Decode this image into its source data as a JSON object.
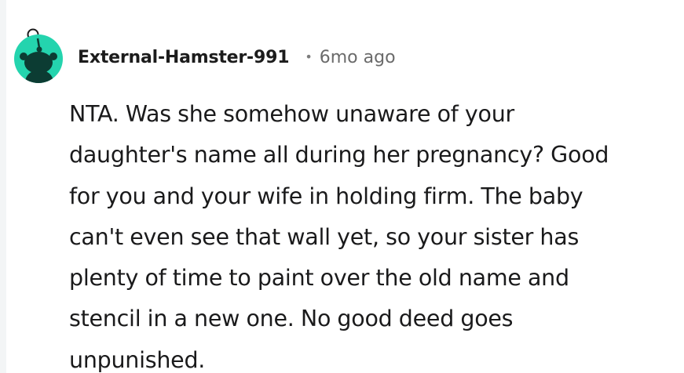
{
  "comment": {
    "author": "External-Hamster-991",
    "separator": "•",
    "timestamp": "6mo ago",
    "avatar_icon": "reddit-snoo-avatar-icon",
    "avatar_color": "#24d4ae",
    "body_lines": [
      "NTA. Was she somehow unaware of your",
      "daughter's name all during her pregnancy? Good",
      "for you and your wife in holding firm. The baby",
      "can't even see that wall yet, so your sister has",
      "plenty of time to paint over the old name and",
      "stencil in a new one. No good deed goes",
      "unpunished."
    ]
  }
}
